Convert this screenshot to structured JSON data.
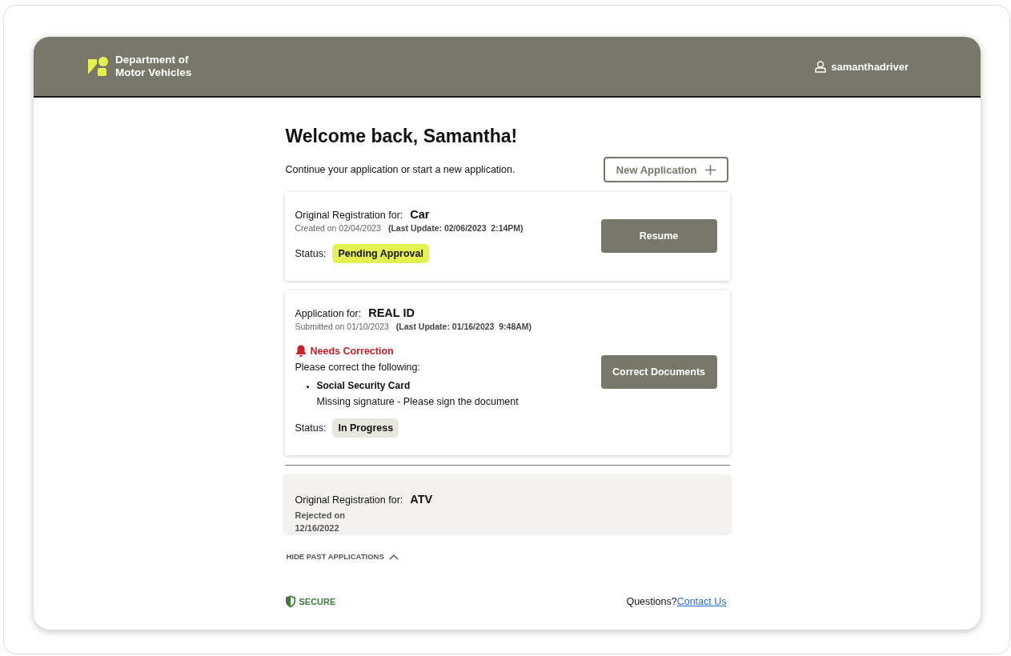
{
  "header": {
    "logo_lines": [
      "Department of",
      "Motor Vehicles"
    ],
    "username": "samanthadriver"
  },
  "greeting": "Welcome back, Samantha!",
  "subtitle": "Continue your application or start a new application.",
  "new_application_button": "New Application",
  "applications": [
    {
      "label": "Original Registration for:",
      "subject": "Car",
      "date": "Created on 02/04/2023",
      "last_update": "(Last Update: 02/06/2023  2:14PM)",
      "status_label": "Status:",
      "status": {
        "text": "Pending Approval",
        "color": "#e4f251"
      },
      "action": "Resume"
    },
    {
      "label": "Application for:",
      "subject": "REAL ID",
      "date": "Submitted on 01/10/2023",
      "last_update": "(Last Update: 01/16/2023  9:48AM)",
      "correction": {
        "title": "Needs Correction",
        "intro": "Please correct the following:",
        "items": [
          {
            "name": "Social Security Card",
            "note": "Missing signature - Please sign the document"
          }
        ]
      },
      "status_label": "Status:",
      "status": {
        "text": "In Progress",
        "color": "#e8e7de"
      },
      "action": "Correct Documents"
    }
  ],
  "past_applications": [
    {
      "label": "Original Registration for:",
      "subject": "ATV",
      "rejected": "Rejected on 12/16/2022"
    }
  ],
  "past_toggle": {
    "label": "HIDE PAST APPLICATIONS",
    "expanded": true
  },
  "footer": {
    "secure": "SECURE",
    "questions": "Questions?",
    "contact": "Contact Us"
  }
}
